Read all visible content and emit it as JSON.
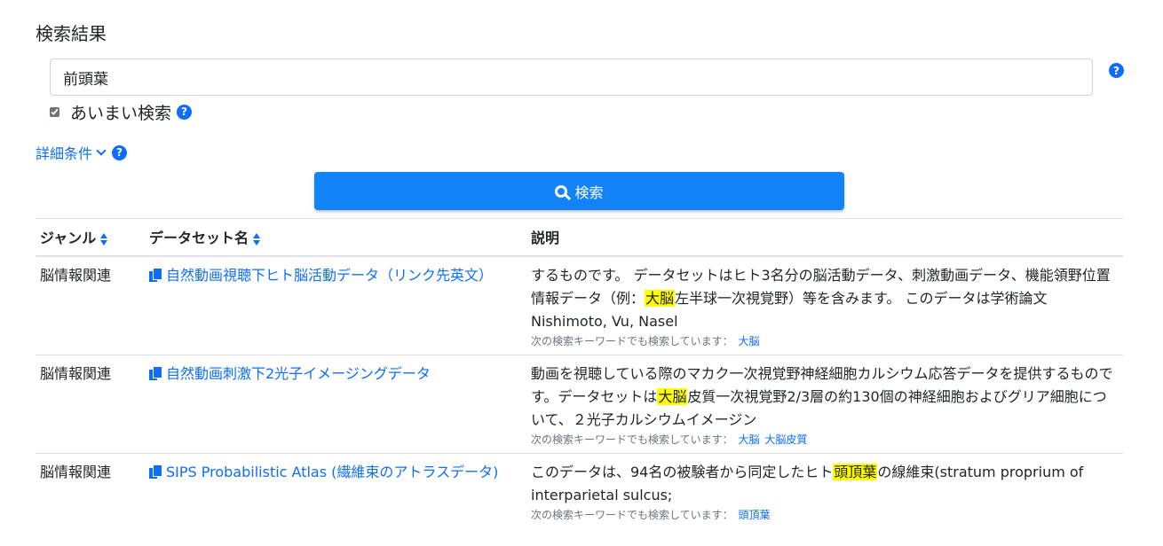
{
  "page_title": "検索結果",
  "search": {
    "value": "前頭葉",
    "fuzzy_label": "あいまい検索",
    "fuzzy_checked": true,
    "detail_label": "詳細条件",
    "button_label": "検索"
  },
  "table": {
    "headers": [
      "ジャンル",
      "データセット名",
      "説明"
    ],
    "keyword_note": "次の検索キーワードでも検索しています：",
    "rows": [
      {
        "genre": "脳情報関連",
        "name": "自然動画視聴下ヒト脳活動データ（リンク先英文）",
        "desc_pre": "するものです。 データセットはヒト3名分の脳活動データ、刺激動画データ、機能領野位置情報データ（例：",
        "desc_hl": "大脳",
        "desc_post": "左半球一次視覚野）等を含みます。 このデータは学術論文 Nishimoto, Vu, Nasel",
        "keywords": [
          "大脳"
        ]
      },
      {
        "genre": "脳情報関連",
        "name": "自然動画刺激下2光子イメージングデータ",
        "desc_pre": "動画を視聴している際のマカク一次視覚野神経細胞カルシウム応答データを提供するものです。データセットは",
        "desc_hl": "大脳",
        "desc_post": "皮質一次視覚野2/3層の約130個の神経細胞およびグリア細胞について、２光子カルシウムイメージン",
        "keywords": [
          "大脳",
          "大脳皮質"
        ]
      },
      {
        "genre": "脳情報関連",
        "name": "SIPS Probabilistic Atlas (繊維束のアトラスデータ)",
        "desc_pre": "このデータは、94名の被験者から同定したヒト",
        "desc_hl": "頭頂葉",
        "desc_post": "の線維束(stratum proprium of interparietal sulcus;",
        "keywords": [
          "頭頂葉"
        ]
      }
    ]
  },
  "colors": {
    "accent": "#0d6efd",
    "button": "#1383f8",
    "highlight": "#ffff00"
  }
}
